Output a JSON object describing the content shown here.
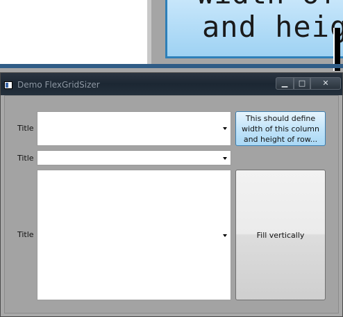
{
  "background_app": {
    "button_text_line1": "width of t",
    "button_text_line2": "and heigh"
  },
  "window": {
    "title": "Demo FlexGridSizer",
    "controls": {
      "minimize": "▁",
      "maximize": "□",
      "close": "✕"
    }
  },
  "rows": [
    {
      "label": "Title"
    },
    {
      "label": "Title"
    },
    {
      "label": "Title"
    }
  ],
  "buttons": {
    "define_label": "This should define width of this column and height of row...",
    "fill_label": "Fill vertically"
  },
  "colors": {
    "titlebar": "#1c2733",
    "client_bg": "#a3a3a3",
    "button_blue": "#c3e4f9",
    "button_gray": "#dddddd"
  }
}
